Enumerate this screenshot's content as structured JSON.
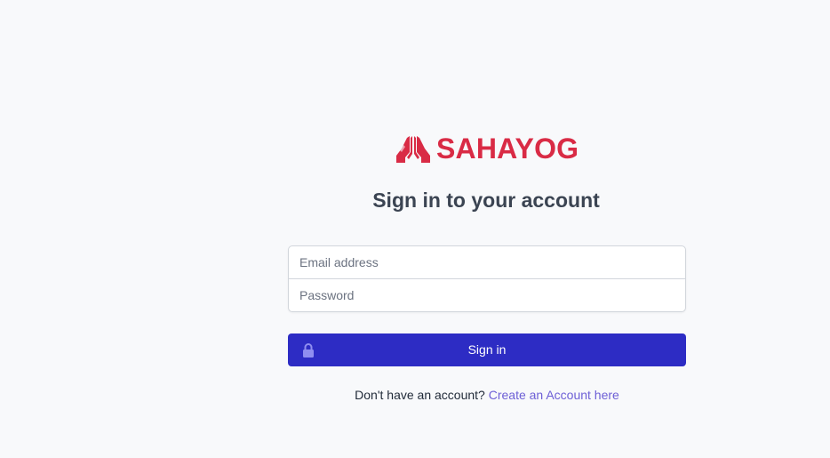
{
  "brand": {
    "name": "SAHAYOG",
    "icon": "praying-hands-icon",
    "color": "#d92b45"
  },
  "heading": {
    "title": "Sign in to your account"
  },
  "form": {
    "email_placeholder": "Email address",
    "password_placeholder": "Password",
    "email_value": "",
    "password_value": ""
  },
  "button": {
    "label": "Sign in",
    "icon": "lock-icon",
    "color": "#2d2cc4"
  },
  "footer": {
    "prompt": "Don't have an account?",
    "link_label": "Create an Account here",
    "link_color": "#6d5fd6"
  }
}
